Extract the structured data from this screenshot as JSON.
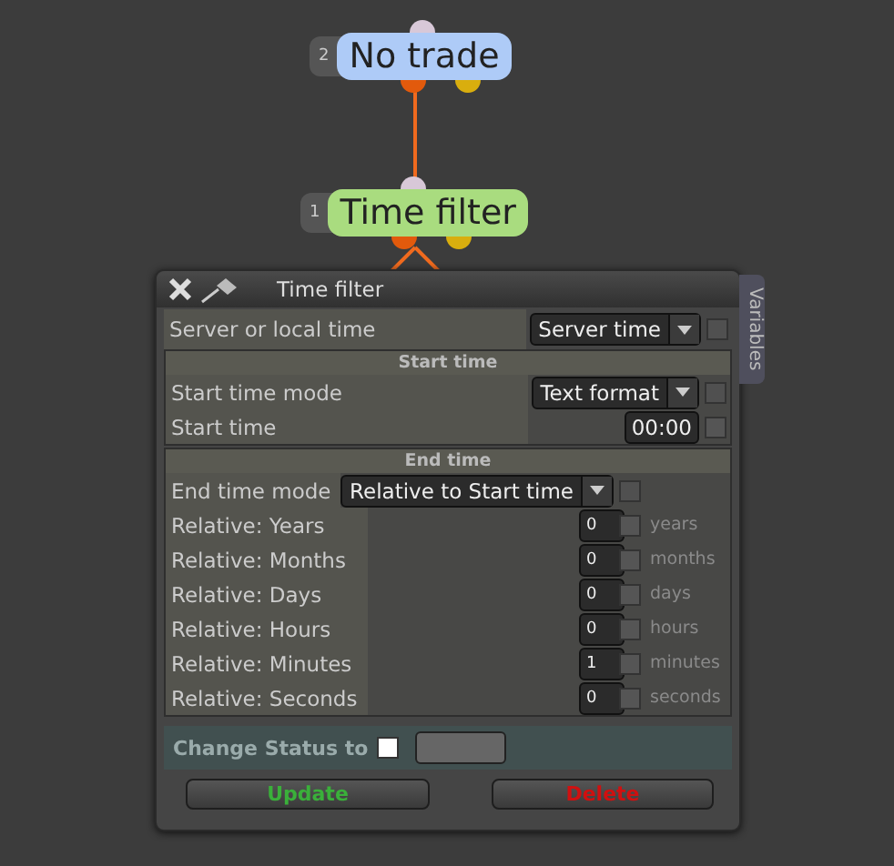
{
  "nodes": [
    {
      "number": "2",
      "label": "No trade",
      "color": "#aecbf7"
    },
    {
      "number": "1",
      "label": "Time filter",
      "color": "#a9dc7f"
    }
  ],
  "panel": {
    "title": "Time filter",
    "side_tab": "Variables",
    "top_rows": [
      {
        "label": "Server or local time",
        "value": "Server time",
        "checked": false
      }
    ],
    "sections": [
      {
        "title": "Start time",
        "rows": [
          {
            "kind": "dropdown",
            "label": "Start time mode",
            "value": "Text format",
            "checked": false
          },
          {
            "kind": "input",
            "label": "Start time",
            "value": "00:00",
            "checked": false
          }
        ]
      },
      {
        "title": "End time",
        "rows": [
          {
            "kind": "dropdown",
            "label": "End time mode",
            "value": "Relative to Start time",
            "checked": false
          },
          {
            "kind": "input",
            "label": "Relative: Years",
            "value": "0",
            "checked": false,
            "unit": "years"
          },
          {
            "kind": "input",
            "label": "Relative: Months",
            "value": "0",
            "checked": false,
            "unit": "months"
          },
          {
            "kind": "input",
            "label": "Relative: Days",
            "value": "0",
            "checked": false,
            "unit": "days"
          },
          {
            "kind": "input",
            "label": "Relative: Hours",
            "value": "0",
            "checked": false,
            "unit": "hours"
          },
          {
            "kind": "input",
            "label": "Relative: Minutes",
            "value": "1",
            "checked": false,
            "unit": "minutes"
          },
          {
            "kind": "input",
            "label": "Relative: Seconds",
            "value": "0",
            "checked": false,
            "unit": "seconds"
          }
        ]
      }
    ],
    "status": {
      "label": "Change Status to",
      "checked": false
    },
    "buttons": [
      {
        "label": "Update",
        "kind": "update"
      },
      {
        "label": "Delete",
        "kind": "delete"
      }
    ]
  }
}
